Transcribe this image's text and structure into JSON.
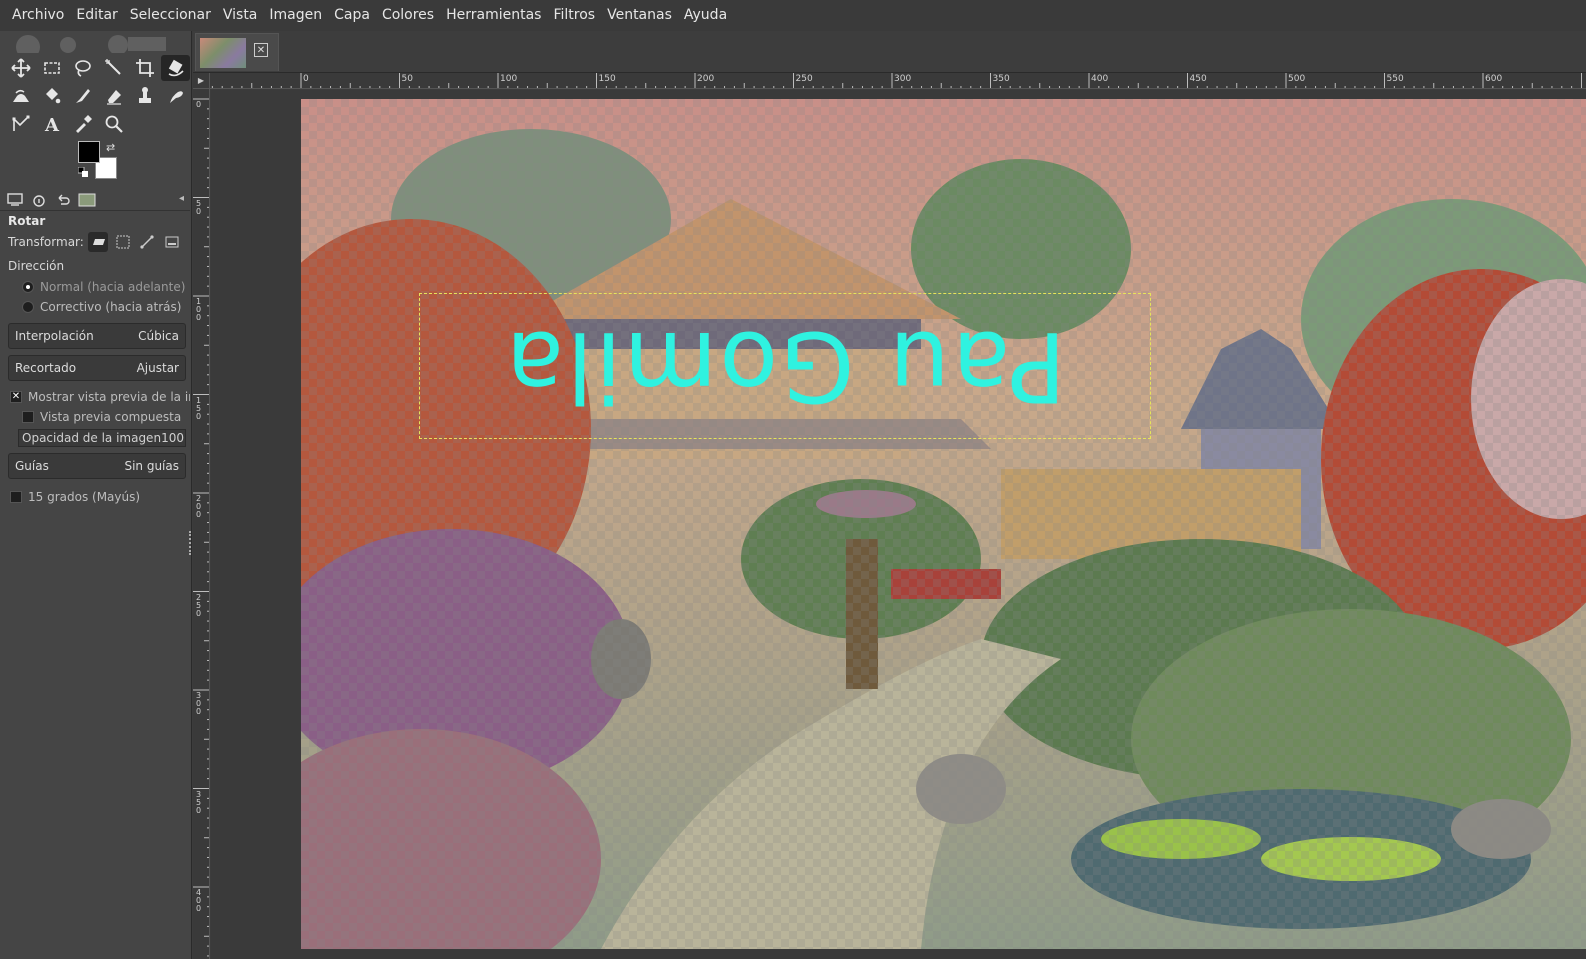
{
  "menu": [
    "Archivo",
    "Editar",
    "Seleccionar",
    "Vista",
    "Imagen",
    "Capa",
    "Colores",
    "Herramientas",
    "Filtros",
    "Ventanas",
    "Ayuda"
  ],
  "tools": [
    "move-tool-icon",
    "rect-select-tool-icon",
    "lasso-tool-icon",
    "fuzzy-select-tool-icon",
    "crop-tool-icon",
    "rotate-tool-icon",
    "warp-tool-icon",
    "bucket-fill-tool-icon",
    "paintbrush-tool-icon",
    "eraser-tool-icon",
    "clone-tool-icon",
    "smudge-tool-icon",
    "path-tool-icon",
    "text-tool-icon",
    "color-picker-tool-icon",
    "zoom-tool-icon"
  ],
  "tool_options": {
    "title": "Rotar",
    "transform_label": "Transformar:",
    "direction_label": "Dirección",
    "direction_normal": "Normal (hacia adelante)",
    "direction_corrective": "Correctivo (hacia atrás)",
    "interpolation_label": "Interpolación",
    "interpolation_value": "Cúbica",
    "clipping_label": "Recortado",
    "clipping_value": "Ajustar",
    "show_preview": "Mostrar vista previa de la ima",
    "composited_preview": "Vista previa compuesta",
    "image_opacity_label": "Opacidad de la imagen",
    "image_opacity_value": "100,",
    "guides_label": "Guías",
    "guides_value": "Sin guías",
    "constrain_label": "15 grados (Mayús)"
  },
  "image_tab": {
    "close_icon": "close-icon"
  },
  "rulers": {
    "horizontal": [
      "0",
      "50",
      "100",
      "150",
      "200",
      "250",
      "300",
      "350",
      "400",
      "450",
      "500",
      "550",
      "600"
    ],
    "vertical": [
      "0",
      "50",
      "100",
      "150",
      "200",
      "250",
      "300",
      "350",
      "400"
    ]
  },
  "canvas": {
    "text_layer": "Pau Gomila",
    "text_color": "#2ff2e0",
    "selection_color": "#e6e45a"
  }
}
